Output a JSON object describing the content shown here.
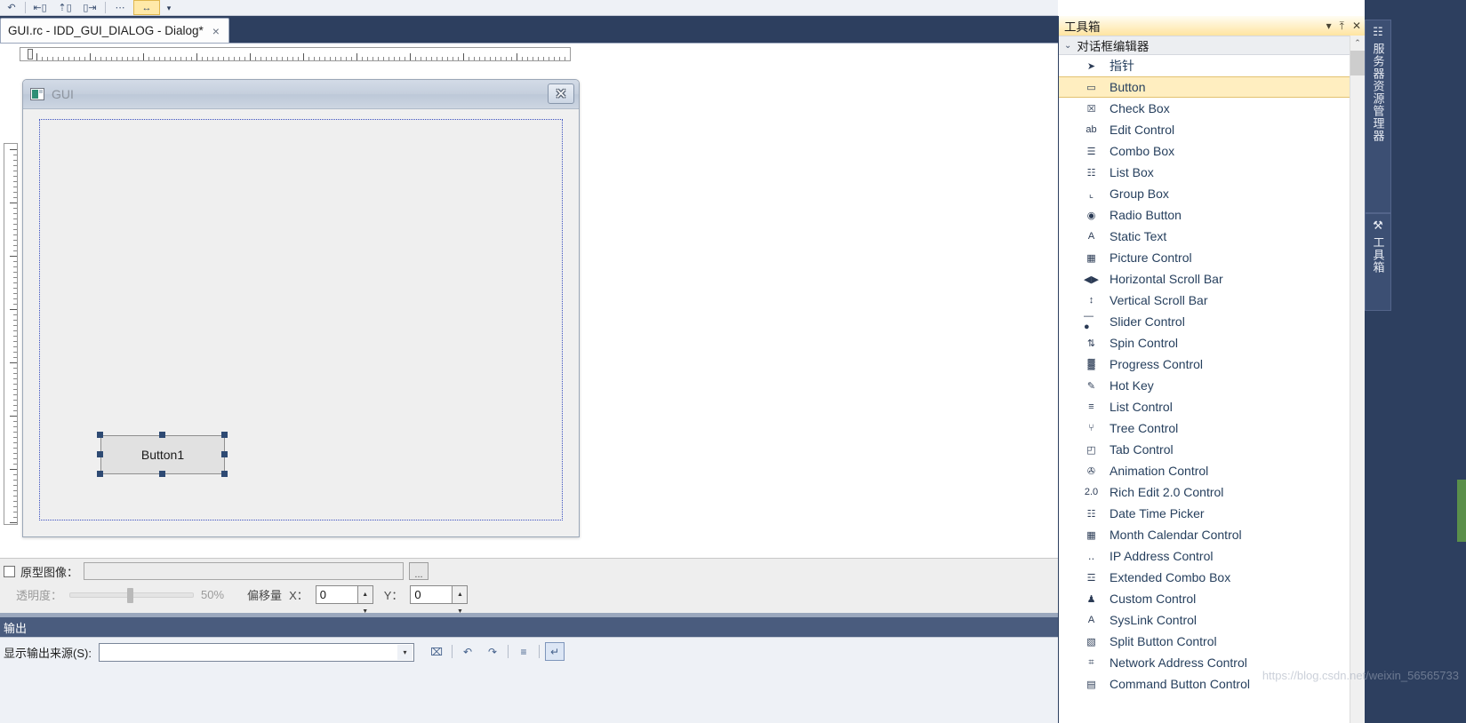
{
  "window": {
    "tab": {
      "title": "GUI.rc - IDD_GUI_DIALOG - Dialog*",
      "close": "×"
    }
  },
  "toolbar": {
    "icons": [
      "undo-icon",
      "redo-icon",
      "align-left-icon",
      "align-top-icon",
      "make-same-size-icon",
      "dots-icon",
      "space-across-icon"
    ],
    "dropdown": "▾"
  },
  "designer": {
    "dialog": {
      "title": "GUI",
      "close_label": "✕",
      "controls": [
        {
          "type": "button",
          "caption": "Button1",
          "selected": true
        }
      ]
    }
  },
  "prototype_bar": {
    "checkbox_checked": false,
    "label": "原型图像：",
    "path_value": "",
    "browse_label": "...",
    "transparency_label": "透明度：",
    "transparency_value": "50%",
    "offset_label": "偏移量",
    "offset_x_label": "X：",
    "offset_x_value": "0",
    "offset_y_label": "Y：",
    "offset_y_value": "0",
    "spin_up": "▲",
    "spin_down": "▼"
  },
  "output": {
    "header": "输出",
    "source_label": "显示输出来源(S):",
    "source_value": "",
    "combo_arrow": "▾",
    "tools": [
      {
        "name": "clear-all-icon",
        "glyph": "⌧"
      },
      {
        "name": "go-to-previous-message-icon",
        "glyph": "↶"
      },
      {
        "name": "go-to-next-message-icon",
        "glyph": "↷"
      },
      {
        "name": "clear-pane-icon",
        "glyph": "≡"
      },
      {
        "name": "toggle-word-wrap-icon",
        "glyph": "↵"
      }
    ]
  },
  "toolbox": {
    "title": "工具箱",
    "title_buttons": [
      {
        "name": "toolbox-menu-button",
        "glyph": "▾"
      },
      {
        "name": "toolbox-pin-button",
        "glyph": "⤒"
      },
      {
        "name": "toolbox-close-button",
        "glyph": "✕"
      }
    ],
    "category": {
      "label": "对话框编辑器",
      "chevron": "⌄"
    },
    "items": [
      {
        "label": "指针",
        "icon": "pointer-icon",
        "glyph": "➤",
        "selected": false
      },
      {
        "label": "Button",
        "icon": "button-icon",
        "glyph": "▭",
        "selected": true
      },
      {
        "label": "Check Box",
        "icon": "check-box-icon",
        "glyph": "☒",
        "selected": false
      },
      {
        "label": "Edit Control",
        "icon": "edit-control-icon",
        "glyph": "ab",
        "selected": false
      },
      {
        "label": "Combo Box",
        "icon": "combo-box-icon",
        "glyph": "☰",
        "selected": false
      },
      {
        "label": "List Box",
        "icon": "list-box-icon",
        "glyph": "☷",
        "selected": false
      },
      {
        "label": "Group Box",
        "icon": "group-box-icon",
        "glyph": "⌞",
        "selected": false
      },
      {
        "label": "Radio Button",
        "icon": "radio-button-icon",
        "glyph": "◉",
        "selected": false
      },
      {
        "label": "Static Text",
        "icon": "static-text-icon",
        "glyph": "A",
        "selected": false
      },
      {
        "label": "Picture Control",
        "icon": "picture-control-icon",
        "glyph": "▦",
        "selected": false
      },
      {
        "label": "Horizontal Scroll Bar",
        "icon": "horizontal-scroll-bar-icon",
        "glyph": "◀▶",
        "selected": false
      },
      {
        "label": "Vertical Scroll Bar",
        "icon": "vertical-scroll-bar-icon",
        "glyph": "↕",
        "selected": false
      },
      {
        "label": "Slider Control",
        "icon": "slider-control-icon",
        "glyph": "—●",
        "selected": false
      },
      {
        "label": "Spin Control",
        "icon": "spin-control-icon",
        "glyph": "⇅",
        "selected": false
      },
      {
        "label": "Progress Control",
        "icon": "progress-control-icon",
        "glyph": "▓",
        "selected": false
      },
      {
        "label": "Hot Key",
        "icon": "hot-key-icon",
        "glyph": "✎",
        "selected": false
      },
      {
        "label": "List Control",
        "icon": "list-control-icon",
        "glyph": "≡",
        "selected": false
      },
      {
        "label": "Tree Control",
        "icon": "tree-control-icon",
        "glyph": "⑂",
        "selected": false
      },
      {
        "label": "Tab Control",
        "icon": "tab-control-icon",
        "glyph": "◰",
        "selected": false
      },
      {
        "label": "Animation Control",
        "icon": "animation-control-icon",
        "glyph": "✇",
        "selected": false
      },
      {
        "label": "Rich Edit 2.0 Control",
        "icon": "rich-edit-control-icon",
        "glyph": "2.0",
        "selected": false
      },
      {
        "label": "Date Time Picker",
        "icon": "date-time-picker-icon",
        "glyph": "☷",
        "selected": false
      },
      {
        "label": "Month Calendar Control",
        "icon": "month-calendar-icon",
        "glyph": "▦",
        "selected": false
      },
      {
        "label": "IP Address Control",
        "icon": "ip-address-control-icon",
        "glyph": "‥",
        "selected": false
      },
      {
        "label": "Extended Combo Box",
        "icon": "extended-combo-box-icon",
        "glyph": "☲",
        "selected": false
      },
      {
        "label": "Custom Control",
        "icon": "custom-control-icon",
        "glyph": "♟",
        "selected": false
      },
      {
        "label": "SysLink Control",
        "icon": "syslink-control-icon",
        "glyph": "A",
        "selected": false
      },
      {
        "label": "Split Button Control",
        "icon": "split-button-control-icon",
        "glyph": "▧",
        "selected": false
      },
      {
        "label": "Network Address Control",
        "icon": "network-address-control-icon",
        "glyph": "⌗",
        "selected": false
      },
      {
        "label": "Command Button Control",
        "icon": "command-button-control-icon",
        "glyph": "▤",
        "selected": false
      }
    ],
    "scrollbar": {
      "up_arrow": "⌃"
    }
  },
  "dock_tabs": [
    {
      "label": "服务器资源管理器",
      "icon": "server-explorer-icon",
      "glyph": "☷"
    },
    {
      "label": "工具箱",
      "icon": "toolbox-icon",
      "glyph": "⚒"
    }
  ],
  "watermark": {
    "text": "https://blog.csdn.net/weixin_56565733"
  },
  "colors": {
    "accent_dark": "#2d3f5f",
    "selection": "#ffeec0",
    "selection_border": "#e2c270",
    "toolbox_title": "#ffe4a0",
    "item_text": "#27405e",
    "handle": "#2e4a73"
  }
}
